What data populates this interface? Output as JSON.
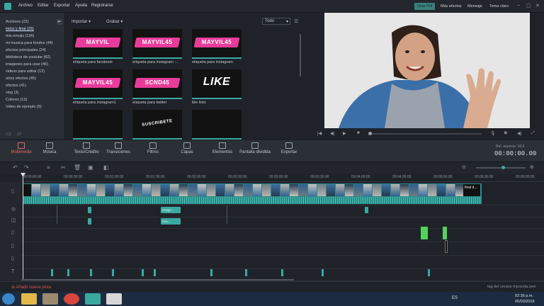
{
  "menu": [
    "Archivo",
    "Editar",
    "Exportar",
    "Ayuda",
    "Registrarse"
  ],
  "top_right": {
    "active_btn": "Usar Pdf",
    "btn2": "Más efectos",
    "btn3": "Mensaje",
    "btn4": "Tema claro"
  },
  "library": [
    "Archivos (22)",
    "inicio y final (25)",
    "mis emojis (136)",
    "mi musica para fondos (44)",
    "efectos principales (24)",
    "biblioteca de youtube (82)",
    "imagenes para usar (46)",
    "videos para editar (12)",
    "otros efectos (45)",
    "efectos (41)",
    "vlog (3)",
    "Colores (13)",
    "Video de ejemplo (9)"
  ],
  "media_toolbar": {
    "import": "Importar",
    "record": "Grabar",
    "filter": "Todo"
  },
  "thumbs": [
    {
      "text": "MAYVIL",
      "label": "etiqueta para facebook"
    },
    {
      "text": "MAYVIL45",
      "label": "etiqueta para instagram -..."
    },
    {
      "text": "MAYVIL45",
      "label": "etiqueta para instagram"
    },
    {
      "text": "MAYVIL45",
      "label": "etiqueta para instagram1"
    },
    {
      "text": "SCND45",
      "label": "etiqueta para twitter"
    },
    {
      "text": "LIKE",
      "label": "like listo"
    },
    {
      "text": "",
      "label": ""
    },
    {
      "text": "SUSCRIBETE",
      "label": ""
    },
    {
      "text": "",
      "label": ""
    }
  ],
  "preview": {
    "aspect": "Rel. aspecto: 16:9",
    "timecode": "00:00:00.00"
  },
  "tools": [
    "Multimedia",
    "Música",
    "Texto/Crédito",
    "Transiciones",
    "Filtros",
    "Capas",
    "Elementos",
    "Pantalla dividida",
    "Exportar"
  ],
  "ruler": [
    "00:00:00:00",
    "00:00:30:00",
    "00:01:00:00",
    "00:01:30:00",
    "00:02:00:00",
    "00:02:30:00",
    "00:03:00:00",
    "00:03:30:00",
    "00:04:00:00",
    "00:04:30:00",
    "00:05:00:00",
    "00:05:30:00",
    "00:06:00:00"
  ],
  "clips": {
    "end_clip": "final d...",
    "clip_a": "Image...",
    "clip_b": "Ima..."
  },
  "bottom": {
    "add_track": "Añadir nueva pista",
    "project": "tag del verano hipocrita.wve"
  },
  "taskbar": {
    "lang": "ES",
    "time": "02:36 p.m.",
    "date": "05/03/2018"
  },
  "colors": {
    "accent": "#3ba8a0",
    "active_tool": "#e26b5c",
    "pink": "#e93c9a"
  }
}
